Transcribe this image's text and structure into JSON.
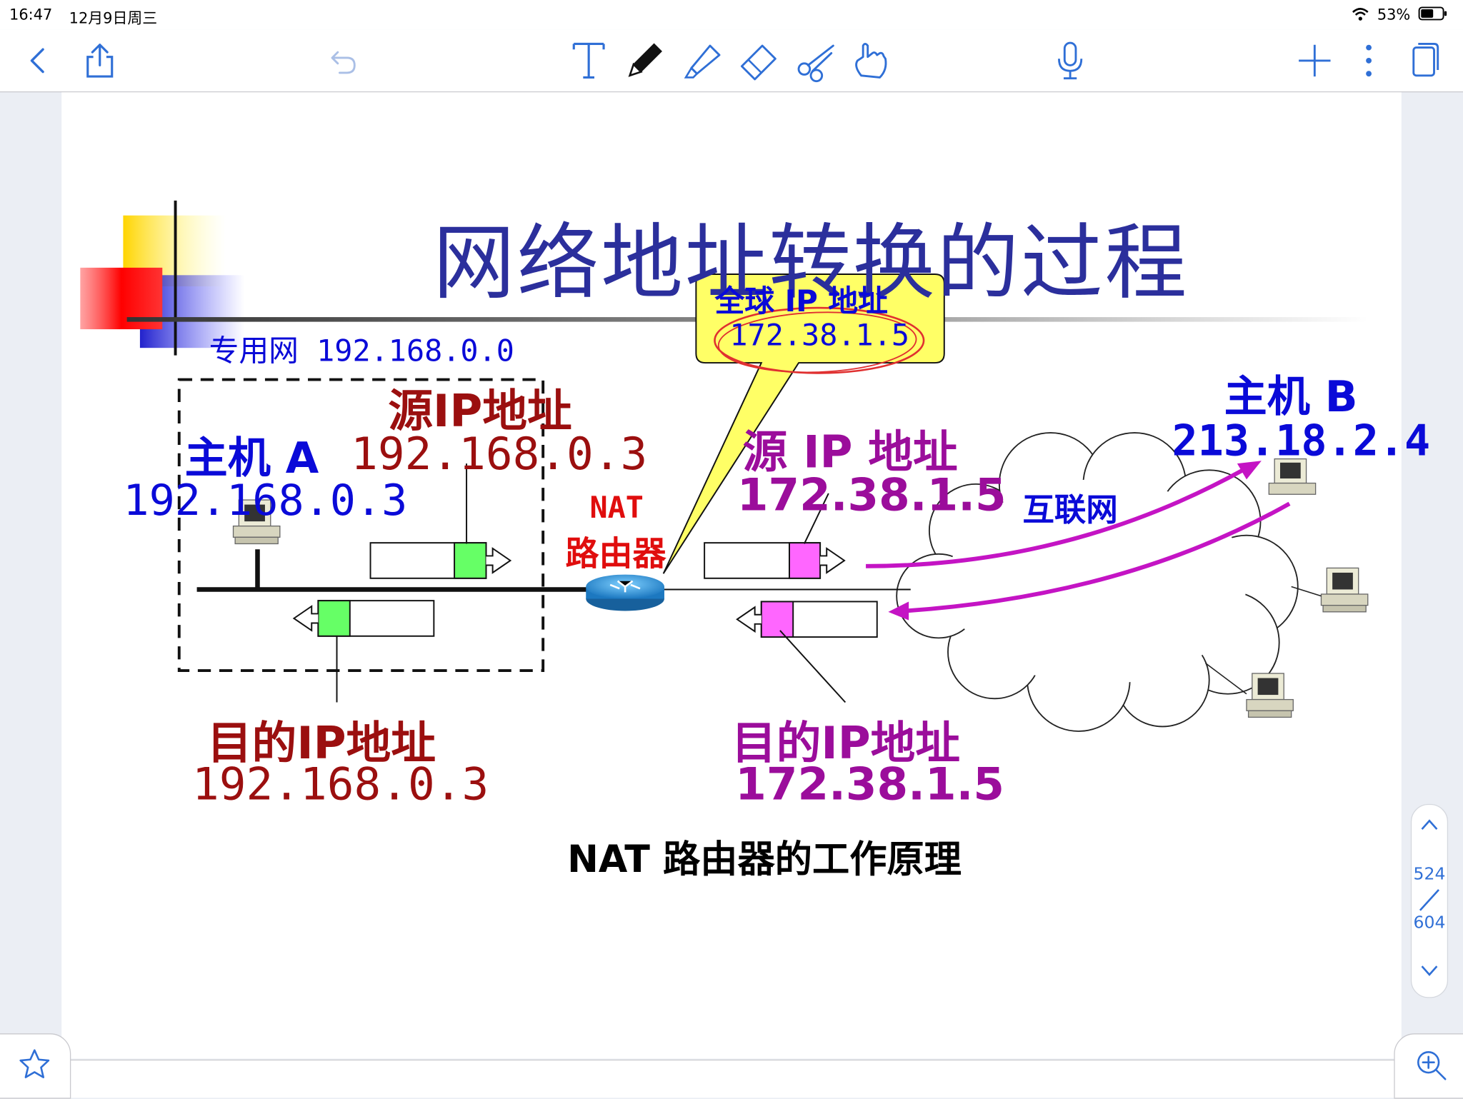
{
  "status_bar": {
    "time": "16:47",
    "date": "12月9日周三",
    "battery": "53%"
  },
  "toolbar": {
    "icons": [
      "back-chevron-icon",
      "share-icon",
      "undo-icon",
      "text-tool-icon",
      "pen-icon",
      "highlighter-icon",
      "eraser-icon",
      "scissors-icon",
      "hand-touch-icon",
      "microphone-icon",
      "add-icon",
      "more-icon",
      "pages-icon"
    ]
  },
  "slide": {
    "title": "网络地址转换的过程",
    "private_net": "专用网 192.168.0.0",
    "global_ip_title": "全球 IP 地址",
    "global_ip_value": "172.38.1.5",
    "host_a_label": "主机 A",
    "host_a_ip": "192.168.0.3",
    "src_left_label": "源IP地址",
    "src_left_ip": "192.168.0.3",
    "dst_left_label": "目的IP地址",
    "dst_left_ip": "192.168.0.3",
    "nat_label": "NAT",
    "router_label": "路由器",
    "src_right_label": "源 IP 地址",
    "src_right_ip": "172.38.1.5",
    "dst_right_label": "目的IP地址",
    "dst_right_ip": "172.38.1.5",
    "host_b_label": "主机 B",
    "host_b_ip": "213.18.2.4",
    "internet_label": "互联网",
    "caption": "NAT 路由器的工作原理"
  },
  "colors": {
    "title_blue": "#2b2f9c",
    "blue": "#0a0ad8",
    "dark_red": "#9b0f0f",
    "purple": "#9b0d9b",
    "red": "#e00d0d",
    "magenta_arrow": "#c414c4",
    "callout_yellow": "#ffff66",
    "packet_green": "#66ff66",
    "packet_pink": "#ff66ff",
    "accent": "#2f6fd6"
  },
  "pager": {
    "current": "524",
    "total": "604"
  }
}
